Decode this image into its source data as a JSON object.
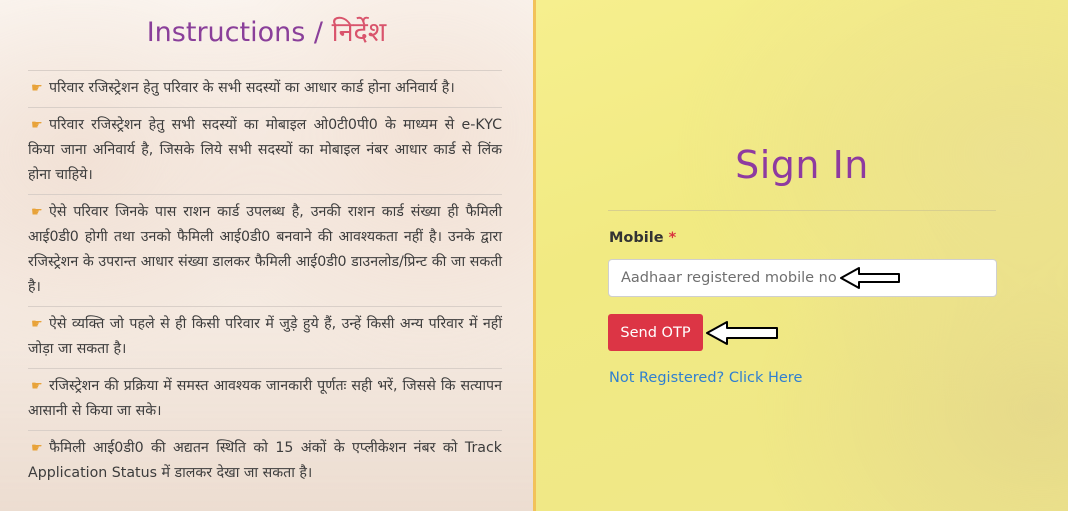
{
  "instructions": {
    "title_en": "Instructions /",
    "title_hi": "निर्देश",
    "items": [
      "परिवार रजिस्ट्रेशन हेतु परिवार के सभी सदस्यों का आधार कार्ड होना अनिवार्य है।",
      "परिवार रजिस्ट्रेशन हेतु सभी सदस्यों का मोबाइल ओ0टी0पी0 के माध्यम से e-KYC किया जाना अनिवार्य है, जिसके लिये सभी सदस्यों का मोबाइल नंबर आधार कार्ड से लिंक होना चाहिये।",
      "ऐसे परिवार जिनके पास राशन कार्ड उपलब्ध है, उनकी राशन कार्ड संख्या ही फैमिली आई0डी0 होगी तथा उनको फैमिली आई0डी0 बनवाने की आवश्यकता नहीं है। उनके द्वारा रजिस्ट्रेशन के उपरान्त आधार संख्या डालकर फैमिली आई0डी0 डाउनलोड/प्रिन्ट की जा सकती है।",
      "ऐसे व्यक्ति जो पहले से ही किसी परिवार में जुड़े हुये हैं, उन्हें किसी अन्य परिवार में नहीं जोड़ा जा सकता है।",
      "रजिस्ट्रेशन की प्रक्रिया में समस्त आवश्यक जानकारी पूर्णतः सही भरें, जिससे कि सत्यापन आसानी से किया जा सके।",
      "फैमिली आई0डी0 की अद्यतन स्थिति को 15 अंकों के एप्लीकेशन नंबर को Track Application Status में डालकर देखा जा सकता है।"
    ]
  },
  "signin": {
    "title": "Sign In",
    "mobile_label": "Mobile",
    "required_mark": "*",
    "mobile_placeholder": "Aadhaar registered mobile no",
    "send_otp_label": "Send OTP",
    "register_link": "Not Registered? Click Here"
  },
  "colors": {
    "accent_purple": "#8e3aa0",
    "button_red": "#dc3545",
    "link_blue": "#2f7fd1"
  },
  "icons": {
    "bullet": "pointing-hand-icon",
    "annotation": "arrow-left-icon"
  }
}
